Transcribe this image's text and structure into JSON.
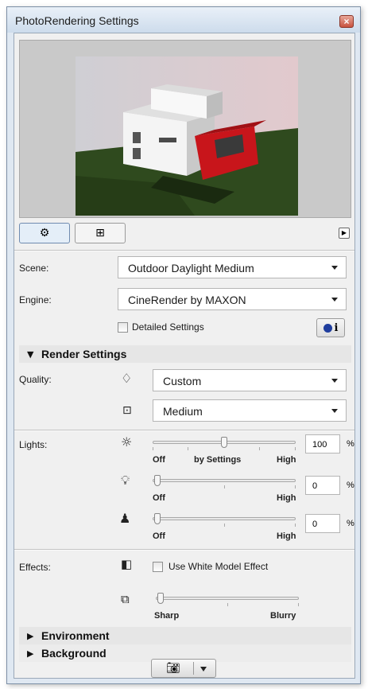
{
  "window": {
    "title": "PhotoRendering Settings",
    "close_glyph": "×"
  },
  "tabs": [
    {
      "icon": "gear-icon",
      "glyph": "⚙",
      "active": true
    },
    {
      "icon": "frame-size-icon",
      "glyph": "⊞",
      "active": false
    }
  ],
  "scene": {
    "label": "Scene:",
    "value": "Outdoor Daylight Medium"
  },
  "engine": {
    "label": "Engine:",
    "value": "CineRender by MAXON"
  },
  "detailed_settings": {
    "label": "Detailed Settings",
    "checked": false
  },
  "info_button": {
    "label": "i"
  },
  "render_settings": {
    "title": "Render Settings",
    "expanded": true
  },
  "quality": {
    "label": "Quality:",
    "options": [
      "Custom",
      "Medium"
    ]
  },
  "lights": {
    "label": "Lights:",
    "rows": [
      {
        "icon": "sun-icon",
        "value": "100",
        "unit": "%",
        "labels": [
          "Off",
          "by Settings",
          "High"
        ]
      },
      {
        "icon": "lightbulb-icon",
        "value": "0",
        "unit": "%",
        "labels": [
          "Off",
          "High"
        ]
      },
      {
        "icon": "lamp-icon",
        "value": "0",
        "unit": "%",
        "labels": [
          "Off",
          "High"
        ]
      }
    ]
  },
  "effects": {
    "label": "Effects:",
    "white_model_label": "Use White Model Effect",
    "white_model_checked": false,
    "blur_labels": [
      "Sharp",
      "Blurry"
    ]
  },
  "sections": [
    {
      "title": "Environment",
      "expanded": false
    },
    {
      "title": "Background",
      "expanded": false
    }
  ],
  "colors": {
    "accent": "#6f8bb0",
    "building_red": "#c8151b",
    "grass": "#2f4a1e"
  }
}
